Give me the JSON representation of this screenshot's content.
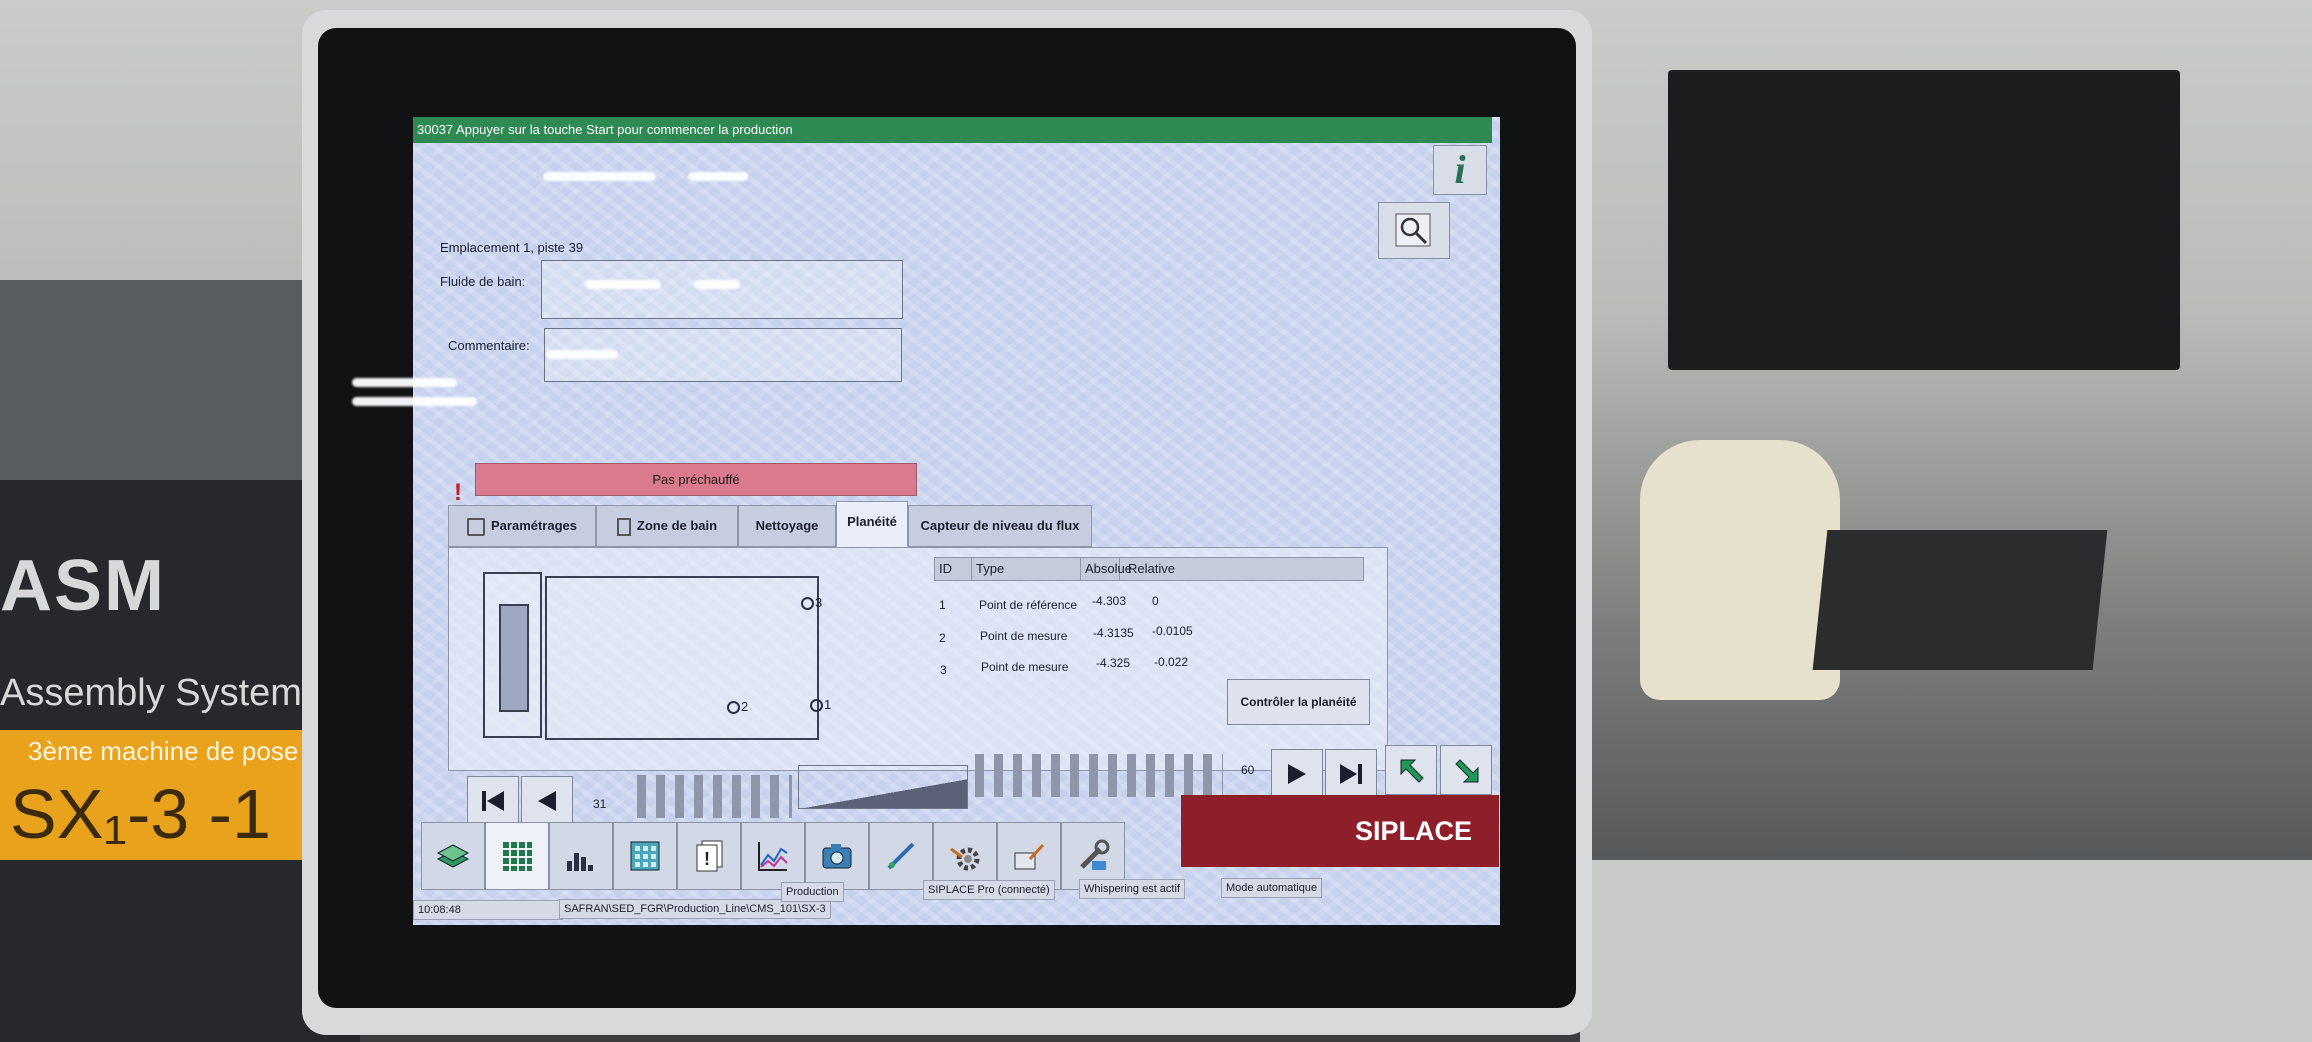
{
  "environment": {
    "logo_text": "ASM",
    "logo_sub": "Assembly Systems",
    "machine_label": "3ème machine de pose",
    "machine_id": "SX₁-3 -1"
  },
  "window": {
    "title": "30037 Appuyer sur la touche Start pour commencer la production"
  },
  "details": {
    "location": "Emplacement 1, piste 39",
    "bath_fluid_label": "Fluide de bain:",
    "bath_fluid_value": "",
    "comment_label": "Commentaire:",
    "comment_value": ""
  },
  "status_warning": {
    "mark": "!",
    "text": "Pas préchauffé"
  },
  "tabs": [
    {
      "label": "Paramétrages",
      "active": false
    },
    {
      "label": "Zone de bain",
      "active": false
    },
    {
      "label": "Nettoyage",
      "active": false
    },
    {
      "label": "Planéité",
      "active": true
    },
    {
      "label": "Capteur de niveau du flux",
      "active": false
    }
  ],
  "diagram_points": [
    "3",
    "2",
    "1"
  ],
  "planarity_table": {
    "columns": [
      "ID",
      "Type",
      "Absolue",
      "Relative"
    ],
    "rows": [
      {
        "id": "1",
        "type": "Point de référence",
        "absolute": "-4.303",
        "relative": "0"
      },
      {
        "id": "2",
        "type": "Point de mesure",
        "absolute": "-4.3135",
        "relative": "-0.0105"
      },
      {
        "id": "3",
        "type": "Point de mesure",
        "absolute": "-4.325",
        "relative": "-0.022"
      }
    ]
  },
  "check_button": "Contrôler la planéité",
  "navigation": {
    "current": "31",
    "total": "60"
  },
  "brand": "SIPLACE",
  "toolbar_icons": [
    "stack-icon",
    "grid-icon",
    "bar-chart-icon",
    "tray-icon",
    "notes-icon",
    "line-chart-icon",
    "camera-icon",
    "tool-icon",
    "gear-icon",
    "feeder-icon",
    "wrench-icon"
  ],
  "statusbar": {
    "time": "10:08:48",
    "path": "SAFRAN\\SED_FGR\\Production_Line\\CMS_101\\SX-3",
    "mode_prod": "Production",
    "connection": "SIPLACE Pro (connecté)",
    "whispering": "Whispering est actif",
    "auto_mode": "Mode automatique"
  },
  "colors": {
    "title_bar": "#2e8a53",
    "warning": "#d97a8e",
    "brand": "#8e1f2a"
  }
}
